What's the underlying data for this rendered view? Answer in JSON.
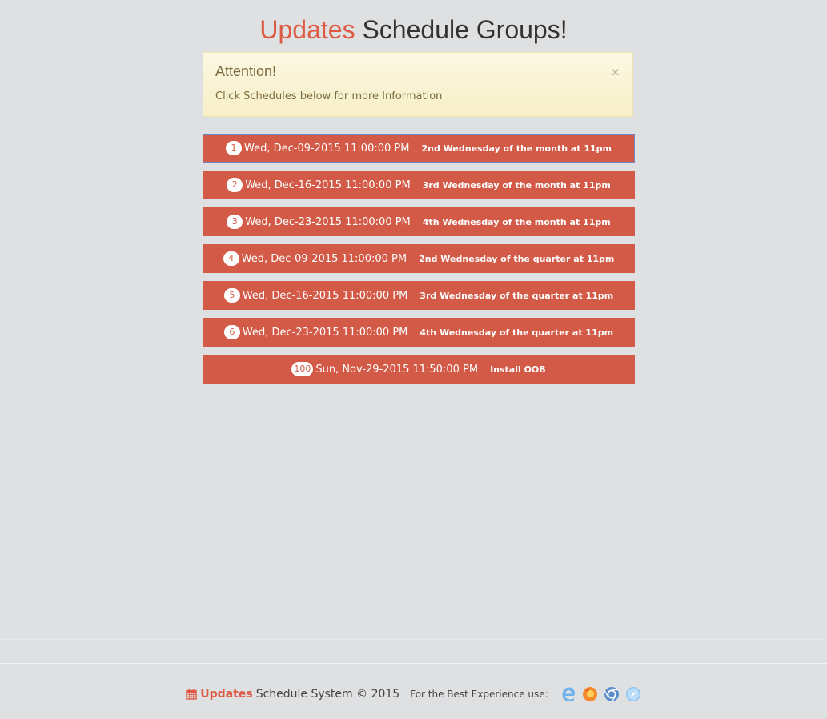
{
  "header": {
    "title_accent": "Updates",
    "title_rest": "Schedule Groups!"
  },
  "alert": {
    "title": "Attention!",
    "body": "Click Schedules below for more Information",
    "close_glyph": "×"
  },
  "schedules": [
    {
      "badge": "1",
      "date": "Wed, Dec-09-2015 11:00:00 PM",
      "desc": "2nd Wednesday of the month at 11pm"
    },
    {
      "badge": "2",
      "date": "Wed, Dec-16-2015 11:00:00 PM",
      "desc": "3rd Wednesday of the month at 11pm"
    },
    {
      "badge": "3",
      "date": "Wed, Dec-23-2015 11:00:00 PM",
      "desc": "4th Wednesday of the month at 11pm"
    },
    {
      "badge": "4",
      "date": "Wed, Dec-09-2015 11:00:00 PM",
      "desc": "2nd Wednesday of the quarter at 11pm"
    },
    {
      "badge": "5",
      "date": "Wed, Dec-16-2015 11:00:00 PM",
      "desc": "3rd Wednesday of the quarter at 11pm"
    },
    {
      "badge": "6",
      "date": "Wed, Dec-23-2015 11:00:00 PM",
      "desc": "4th Wednesday of the quarter at 11pm"
    },
    {
      "badge": "100",
      "date": "Sun, Nov-29-2015 11:50:00 PM",
      "desc": "Install OOB"
    }
  ],
  "footer": {
    "brand": "Updates",
    "system_text": "Schedule System © 2015",
    "best_experience": "For the Best Experience use:",
    "icons": [
      "calendar-icon",
      "edge-icon",
      "firefox-icon",
      "chrome-icon",
      "safari-icon"
    ]
  },
  "colors": {
    "accent": "#dd5a43",
    "schedule_bg": "#d25a47",
    "page_bg": "#dfe0e2",
    "alert_bg": "#fcf8e3"
  }
}
